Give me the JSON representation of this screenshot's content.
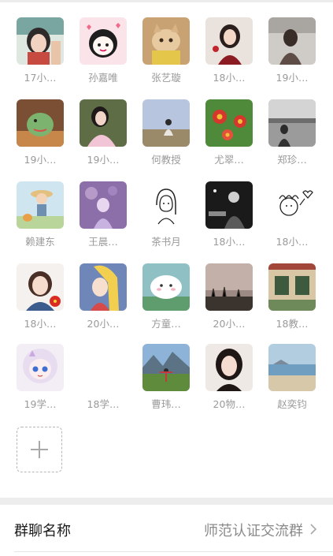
{
  "members": [
    {
      "name": "17小…",
      "avatar": "avatar-cartoon-girl-teal"
    },
    {
      "name": "孙嘉唯",
      "avatar": "avatar-cartoon-girl-pink"
    },
    {
      "name": "张艺璇",
      "avatar": "avatar-cat-photo"
    },
    {
      "name": "18小…",
      "avatar": "avatar-illustrated-woman"
    },
    {
      "name": "19小…",
      "avatar": "avatar-girl-photo"
    },
    {
      "name": "19小…",
      "avatar": "avatar-green-dino"
    },
    {
      "name": "19小…",
      "avatar": "avatar-girl-pink-dress"
    },
    {
      "name": "何教授",
      "avatar": "avatar-person-field"
    },
    {
      "name": "尤翠…",
      "avatar": "avatar-red-flowers"
    },
    {
      "name": "郑珍…",
      "avatar": "avatar-bw-photo"
    },
    {
      "name": "赖建东",
      "avatar": "avatar-cartoon-boy-hat"
    },
    {
      "name": "王晨…",
      "avatar": "avatar-purple-illustration"
    },
    {
      "name": "茶书月",
      "avatar": "avatar-line-sketch-girl"
    },
    {
      "name": "18小…",
      "avatar": "avatar-dark-musician"
    },
    {
      "name": "18小…",
      "avatar": "avatar-doodle-girl-heart"
    },
    {
      "name": "18小…",
      "avatar": "avatar-anime-girl-flag"
    },
    {
      "name": "20小…",
      "avatar": "avatar-anime-blonde"
    },
    {
      "name": "方童…",
      "avatar": "avatar-cute-cloud"
    },
    {
      "name": "20小…",
      "avatar": "avatar-sunset-grass"
    },
    {
      "name": "18教…",
      "avatar": "avatar-building-window"
    },
    {
      "name": "19学…",
      "avatar": "avatar-anime-white-hair"
    },
    {
      "name": "18学…",
      "avatar": "avatar-blank"
    },
    {
      "name": "曹玮…",
      "avatar": "avatar-mountain-person"
    },
    {
      "name": "20物…",
      "avatar": "avatar-woman-portrait"
    },
    {
      "name": "赵奕钧",
      "avatar": "avatar-beach"
    }
  ],
  "add_button": {
    "icon": "plus-icon"
  },
  "group_name": {
    "label": "群聊名称",
    "value": "师范认证交流群",
    "icon": "chevron-right-icon"
  }
}
